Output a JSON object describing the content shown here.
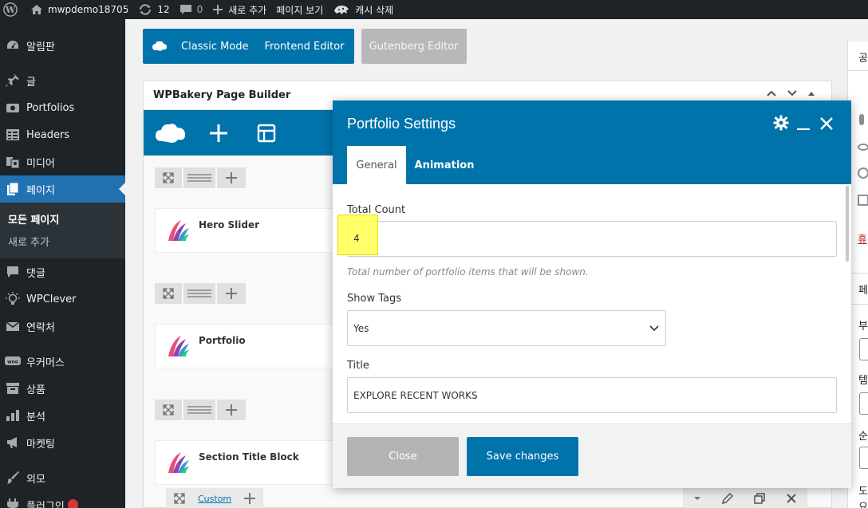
{
  "admin_bar": {
    "site_name": "mwpdemo18705",
    "updates_count": "12",
    "comments_count": "0",
    "new_label": "새로 추가",
    "view_page_label": "페이지 보기",
    "clear_cache_label": "캐시 삭제"
  },
  "sidebar": {
    "items": [
      {
        "label": "알림판",
        "icon": "dashboard-icon"
      },
      {
        "label": "글",
        "icon": "pin-icon"
      },
      {
        "label": "Portfolios",
        "icon": "portfolio-icon"
      },
      {
        "label": "Headers",
        "icon": "table-icon"
      },
      {
        "label": "미디어",
        "icon": "media-icon"
      },
      {
        "label": "페이지",
        "icon": "pages-icon"
      },
      {
        "label": "댓글",
        "icon": "comment-icon"
      },
      {
        "label": "WPClever",
        "icon": "lightbulb-icon"
      },
      {
        "label": "연락처",
        "icon": "mail-icon"
      },
      {
        "label": "우커머스",
        "icon": "woo-icon"
      },
      {
        "label": "상품",
        "icon": "archive-icon"
      },
      {
        "label": "분석",
        "icon": "chart-icon"
      },
      {
        "label": "마켓팅",
        "icon": "megaphone-icon"
      },
      {
        "label": "외모",
        "icon": "brush-icon"
      },
      {
        "label": "플러그인",
        "icon": "plugin-icon"
      }
    ],
    "submenu": [
      "모든 페이지",
      "새로 추가"
    ]
  },
  "mode_bar": {
    "classic": "Classic Mode",
    "frontend": "Frontend Editor",
    "gutenberg": "Gutenberg Editor"
  },
  "wpb": {
    "title": "WPBakery Page Builder",
    "elements": [
      "Hero Slider",
      "Portfolio",
      "Section Title Block"
    ],
    "custom_label": "Custom"
  },
  "modal": {
    "title": "Portfolio Settings",
    "tabs": [
      "General",
      "Animation"
    ],
    "total_count_label": "Total Count",
    "total_count_value": "4",
    "total_count_hint": "Total number of portfolio items that will be shown.",
    "show_tags_label": "Show Tags",
    "show_tags_value": "Yes",
    "title_label": "Title",
    "title_value": "EXPLORE RECENT WORKS",
    "close_label": "Close",
    "save_label": "Save changes"
  },
  "right_panel": {
    "chars": [
      "공",
      "휴",
      "페",
      "부",
      "템",
      "순",
      "도",
      "요"
    ]
  },
  "colors": {
    "wp_dark": "#1d2327",
    "wp_blue": "#2271b1",
    "wpb_blue": "#0073aa",
    "highlight": "#ffff66"
  }
}
